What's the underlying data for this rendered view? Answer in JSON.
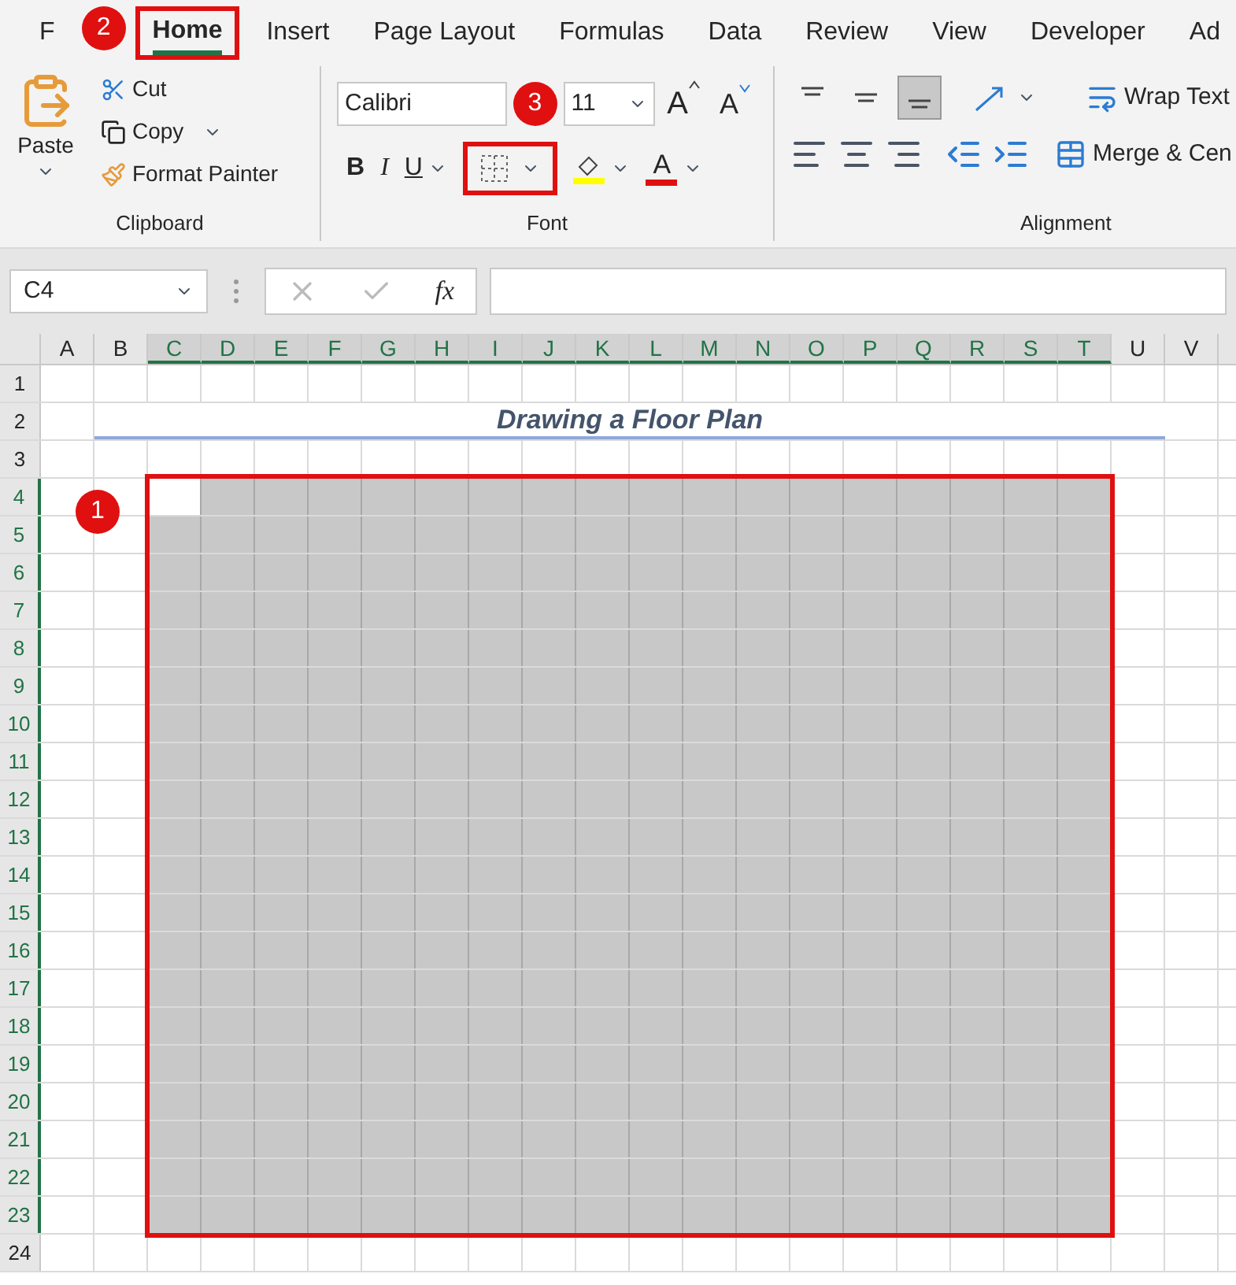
{
  "ribbon_tabs": [
    {
      "label": "F",
      "selected": false,
      "highlighted": false
    },
    {
      "label": "Home",
      "selected": true,
      "highlighted": true
    },
    {
      "label": "Insert",
      "selected": false,
      "highlighted": false
    },
    {
      "label": "Page Layout",
      "selected": false,
      "highlighted": false
    },
    {
      "label": "Formulas",
      "selected": false,
      "highlighted": false
    },
    {
      "label": "Data",
      "selected": false,
      "highlighted": false
    },
    {
      "label": "Review",
      "selected": false,
      "highlighted": false
    },
    {
      "label": "View",
      "selected": false,
      "highlighted": false
    },
    {
      "label": "Developer",
      "selected": false,
      "highlighted": false
    },
    {
      "label": "Ad",
      "selected": false,
      "highlighted": false
    }
  ],
  "clipboard": {
    "paste": "Paste",
    "cut": "Cut",
    "copy": "Copy",
    "format_painter": "Format Painter",
    "label": "Clipboard"
  },
  "font": {
    "font_name": "Calibri",
    "font_size": "11",
    "grow": "A",
    "shrink": "A",
    "bold": "B",
    "italic": "I",
    "underline": "U",
    "borders_highlighted": true,
    "font_color": "A",
    "label": "Font"
  },
  "alignment": {
    "bottom_align_selected": true,
    "wrap_text": "Wrap Text",
    "merge": "Merge & Cen",
    "label": "Alignment"
  },
  "formula_bar": {
    "name_box": "C4",
    "fx": "fx"
  },
  "columns": [
    {
      "label": "A",
      "selected": false
    },
    {
      "label": "B",
      "selected": false
    },
    {
      "label": "C",
      "selected": true
    },
    {
      "label": "D",
      "selected": true
    },
    {
      "label": "E",
      "selected": true
    },
    {
      "label": "F",
      "selected": true
    },
    {
      "label": "G",
      "selected": true
    },
    {
      "label": "H",
      "selected": true
    },
    {
      "label": "I",
      "selected": true
    },
    {
      "label": "J",
      "selected": true
    },
    {
      "label": "K",
      "selected": true
    },
    {
      "label": "L",
      "selected": true
    },
    {
      "label": "M",
      "selected": true
    },
    {
      "label": "N",
      "selected": true
    },
    {
      "label": "O",
      "selected": true
    },
    {
      "label": "P",
      "selected": true
    },
    {
      "label": "Q",
      "selected": true
    },
    {
      "label": "R",
      "selected": true
    },
    {
      "label": "S",
      "selected": true
    },
    {
      "label": "T",
      "selected": true
    },
    {
      "label": "U",
      "selected": false
    },
    {
      "label": "V",
      "selected": false
    }
  ],
  "rows": [
    {
      "label": "1",
      "selected": false
    },
    {
      "label": "2",
      "selected": false
    },
    {
      "label": "3",
      "selected": false
    },
    {
      "label": "4",
      "selected": true
    },
    {
      "label": "5",
      "selected": true
    },
    {
      "label": "6",
      "selected": true
    },
    {
      "label": "7",
      "selected": true
    },
    {
      "label": "8",
      "selected": true
    },
    {
      "label": "9",
      "selected": true
    },
    {
      "label": "10",
      "selected": true
    },
    {
      "label": "11",
      "selected": true
    },
    {
      "label": "12",
      "selected": true
    },
    {
      "label": "13",
      "selected": true
    },
    {
      "label": "14",
      "selected": true
    },
    {
      "label": "15",
      "selected": true
    },
    {
      "label": "16",
      "selected": true
    },
    {
      "label": "17",
      "selected": true
    },
    {
      "label": "18",
      "selected": true
    },
    {
      "label": "19",
      "selected": true
    },
    {
      "label": "20",
      "selected": true
    },
    {
      "label": "21",
      "selected": true
    },
    {
      "label": "22",
      "selected": true
    },
    {
      "label": "23",
      "selected": true
    },
    {
      "label": "24",
      "selected": false
    }
  ],
  "sheet_title": "Drawing a Floor Plan",
  "selection_highlighted": true,
  "step_badges": [
    {
      "label": "1"
    },
    {
      "label": "2"
    },
    {
      "label": "3"
    }
  ]
}
